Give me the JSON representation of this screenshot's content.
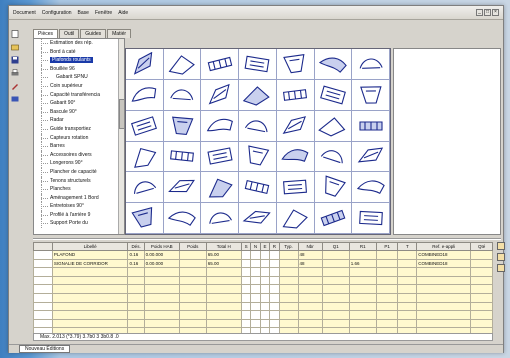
{
  "menubar": {
    "items": [
      "Document",
      "Configuration",
      "Base",
      "Fenêtre",
      "Aide"
    ]
  },
  "tabs": [
    "Pièces",
    "Outil",
    "Guides",
    "Matiér"
  ],
  "tree": {
    "items": [
      {
        "label": "Estimation des rép.",
        "sel": false,
        "lvl": 1
      },
      {
        "label": "Bord à caté",
        "sel": false,
        "lvl": 1
      },
      {
        "label": "Plafonds roulants",
        "sel": true,
        "lvl": 1
      },
      {
        "label": "Bouillée 96",
        "sel": false,
        "lvl": 1
      },
      {
        "label": "Gabarit SPNU",
        "sel": false,
        "lvl": 2
      },
      {
        "label": "Coin supérieur",
        "sel": false,
        "lvl": 1
      },
      {
        "label": "Capacité transférencia",
        "sel": false,
        "lvl": 1
      },
      {
        "label": "Gabarit 90°",
        "sel": false,
        "lvl": 1
      },
      {
        "label": "Bascule 90°",
        "sel": false,
        "lvl": 1
      },
      {
        "label": "Radar",
        "sel": false,
        "lvl": 1
      },
      {
        "label": "Guide transportiez",
        "sel": false,
        "lvl": 1
      },
      {
        "label": "Capteurs rotation",
        "sel": false,
        "lvl": 1
      },
      {
        "label": "Barres",
        "sel": false,
        "lvl": 1
      },
      {
        "label": "Accessoires divers",
        "sel": false,
        "lvl": 1
      },
      {
        "label": "Longerons 90°",
        "sel": false,
        "lvl": 1
      },
      {
        "label": "Plancher de capacité",
        "sel": false,
        "lvl": 1
      },
      {
        "label": "Tenons structurels",
        "sel": false,
        "lvl": 1
      },
      {
        "label": "Planches",
        "sel": false,
        "lvl": 1
      },
      {
        "label": "Aménagement 1 Bord",
        "sel": false,
        "lvl": 1
      },
      {
        "label": "Entretoises 90°",
        "sel": false,
        "lvl": 1
      },
      {
        "label": "Profilé à l'arrière 9",
        "sel": false,
        "lvl": 1
      },
      {
        "label": "Support Porte du",
        "sel": false,
        "lvl": 1
      }
    ]
  },
  "table": {
    "headers": [
      "",
      "Libellé",
      "Dés.",
      "Poids HAB",
      "Poids",
      "Total H",
      "S",
      "N",
      "E",
      "R",
      "Typ.",
      "Nbr",
      "Q1",
      "R1",
      "P1",
      "T",
      "Ref. e-appli",
      "Qté"
    ],
    "rows": [
      [
        "",
        "PLAFOND",
        "0.16",
        "0.00.000",
        "",
        "65.00",
        "",
        "",
        "",
        "",
        "",
        "48",
        "",
        "",
        "",
        "",
        "COMBINED18",
        ""
      ],
      [
        "",
        "SIGNALIE DE CORRIDOR",
        "0.16",
        "0.00.000",
        "",
        "65.00",
        "",
        "",
        "",
        "",
        "",
        "48",
        "",
        "1.66",
        "",
        "",
        "COMBINED18",
        ""
      ],
      [
        "",
        "",
        "",
        "",
        "",
        "",
        "",
        "",
        "",
        "",
        "",
        "",
        "",
        "",
        "",
        "",
        "",
        ""
      ],
      [
        "",
        "",
        "",
        "",
        "",
        "",
        "",
        "",
        "",
        "",
        "",
        "",
        "",
        "",
        "",
        "",
        "",
        ""
      ],
      [
        "",
        "",
        "",
        "",
        "",
        "",
        "",
        "",
        "",
        "",
        "",
        "",
        "",
        "",
        "",
        "",
        "",
        ""
      ],
      [
        "",
        "",
        "",
        "",
        "",
        "",
        "",
        "",
        "",
        "",
        "",
        "",
        "",
        "",
        "",
        "",
        "",
        ""
      ],
      [
        "",
        "",
        "",
        "",
        "",
        "",
        "",
        "",
        "",
        "",
        "",
        "",
        "",
        "",
        "",
        "",
        "",
        ""
      ],
      [
        "",
        "",
        "",
        "",
        "",
        "",
        "",
        "",
        "",
        "",
        "",
        "",
        "",
        "",
        "",
        "",
        "",
        ""
      ],
      [
        "",
        "",
        "",
        "",
        "",
        "",
        "",
        "",
        "",
        "",
        "",
        "",
        "",
        "",
        "",
        "",
        "",
        ""
      ],
      [
        "",
        "",
        "",
        "",
        "",
        "",
        "",
        "",
        "",
        "",
        "",
        "",
        "",
        "",
        "",
        "",
        "",
        ""
      ]
    ]
  },
  "footer_row": "Max. 2.013 (*3.79) 3.7b0 3 3b0.8 .0",
  "bottom_tab": "Nouveau Éditions",
  "colors": {
    "selection": "#1a3aa8",
    "grid_line": "#9aa3c8",
    "table_bg": "#fff9cf"
  }
}
